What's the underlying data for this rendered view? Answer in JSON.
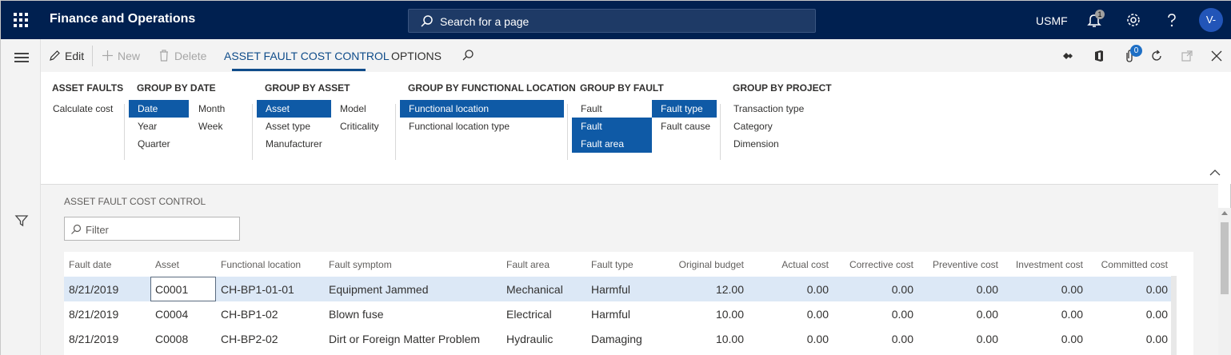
{
  "topbar": {
    "app_title": "Finance and Operations",
    "search_placeholder": "Search for a page",
    "company": "USMF",
    "notification_count": "1",
    "avatar_initials": "V-"
  },
  "actionpane": {
    "edit": "Edit",
    "new": "New",
    "delete": "Delete",
    "active_tab": "ASSET FAULT COST CONTROL",
    "options_tab": "OPTIONS",
    "attach_count": "0"
  },
  "ribbon": {
    "asset_faults": {
      "title": "ASSET FAULTS",
      "items": [
        "Calculate cost"
      ]
    },
    "group_by_date": {
      "title": "GROUP BY DATE",
      "items": [
        "Date",
        "Month",
        "Year",
        "Week",
        "Quarter"
      ],
      "selected": [
        "Date"
      ]
    },
    "group_by_asset": {
      "title": "GROUP BY ASSET",
      "items": [
        "Asset",
        "Model",
        "Asset type",
        "Criticality",
        "Manufacturer"
      ],
      "selected": [
        "Asset"
      ]
    },
    "group_by_functional_location": {
      "title": "GROUP BY FUNCTIONAL LOCATION",
      "items": [
        "Functional location",
        "Functional location type"
      ],
      "selected": [
        "Functional location"
      ]
    },
    "group_by_fault": {
      "title": "GROUP BY FAULT",
      "items": [
        "Fault",
        "Fault type",
        "Fault symptom",
        "Fault cause",
        "Fault area"
      ],
      "selected": [
        "Fault type",
        "Fault symptom",
        "Fault area"
      ]
    },
    "group_by_project": {
      "title": "GROUP BY PROJECT",
      "items": [
        "Transaction type",
        "Category",
        "Dimension"
      ]
    }
  },
  "content": {
    "section_title": "ASSET FAULT COST CONTROL",
    "filter_placeholder": "Filter"
  },
  "grid": {
    "columns": [
      "Fault date",
      "Asset",
      "Functional location",
      "Fault symptom",
      "Fault area",
      "Fault type",
      "Original budget",
      "Actual cost",
      "Corrective cost",
      "Preventive cost",
      "Investment cost",
      "Committed cost"
    ],
    "rows": [
      [
        "8/21/2019",
        "C0001",
        "CH-BP1-01-01",
        "Equipment Jammed",
        "Mechanical",
        "Harmful",
        "12.00",
        "0.00",
        "0.00",
        "0.00",
        "0.00",
        "0.00"
      ],
      [
        "8/21/2019",
        "C0004",
        "CH-BP1-02",
        "Blown fuse",
        "Electrical",
        "Harmful",
        "10.00",
        "0.00",
        "0.00",
        "0.00",
        "0.00",
        "0.00"
      ],
      [
        "8/21/2019",
        "C0008",
        "CH-BP2-02",
        "Dirt or Foreign Matter Problem",
        "Hydraulic",
        "Damaging",
        "10.00",
        "0.00",
        "0.00",
        "0.00",
        "0.00",
        "0.00"
      ]
    ],
    "selected_row": 0
  },
  "colors": {
    "topbar_bg": "#002050",
    "accent": "#0f4c8a",
    "selected_button": "#0f5aa6",
    "selected_row": "#dce8f6"
  }
}
